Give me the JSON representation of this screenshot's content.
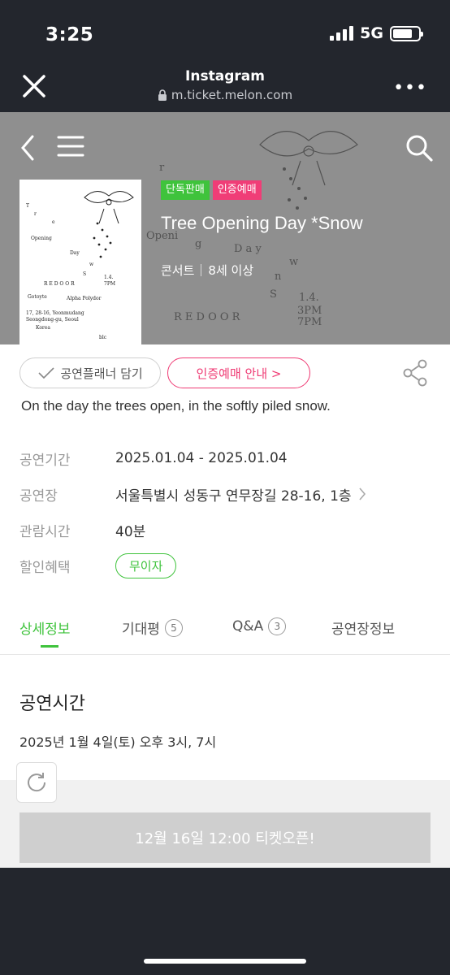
{
  "status_bar": {
    "time": "3:25",
    "network": "5G"
  },
  "browser": {
    "app_title": "Instagram",
    "url": "m.ticket.melon.com"
  },
  "product": {
    "badges": [
      "단독판매",
      "인증예매"
    ],
    "title": "Tree Opening Day *Snow",
    "category": "콘서트",
    "age": "8세 이상",
    "description": "On the day the trees open, in the softly piled snow."
  },
  "actions": {
    "planner_label": "공연플래너 담기",
    "auth_label": "인증예매 안내 >"
  },
  "info": [
    {
      "label": "공연기간",
      "value": "2025.01.04 - 2025.01.04"
    },
    {
      "label": "공연장",
      "value": "서울특별시 성동구 연무장길 28-16, 1층"
    },
    {
      "label": "관람시간",
      "value": "40분"
    },
    {
      "label": "할인혜택",
      "value": "무이자"
    }
  ],
  "tabs": [
    {
      "label": "상세정보",
      "count": ""
    },
    {
      "label": "기대평",
      "count": "5"
    },
    {
      "label": "Q&A",
      "count": "3"
    },
    {
      "label": "공연장정보",
      "count": ""
    }
  ],
  "detail": {
    "heading": "공연시간",
    "text": "2025년 1월 4일(토) 오후 3시, 7시"
  },
  "ticket_button": "12월 16일 12:00 티켓오픈!",
  "colors": {
    "accent_green": "#3fc33c",
    "accent_pink": "#f03d77",
    "status_bg": "#23262d"
  }
}
